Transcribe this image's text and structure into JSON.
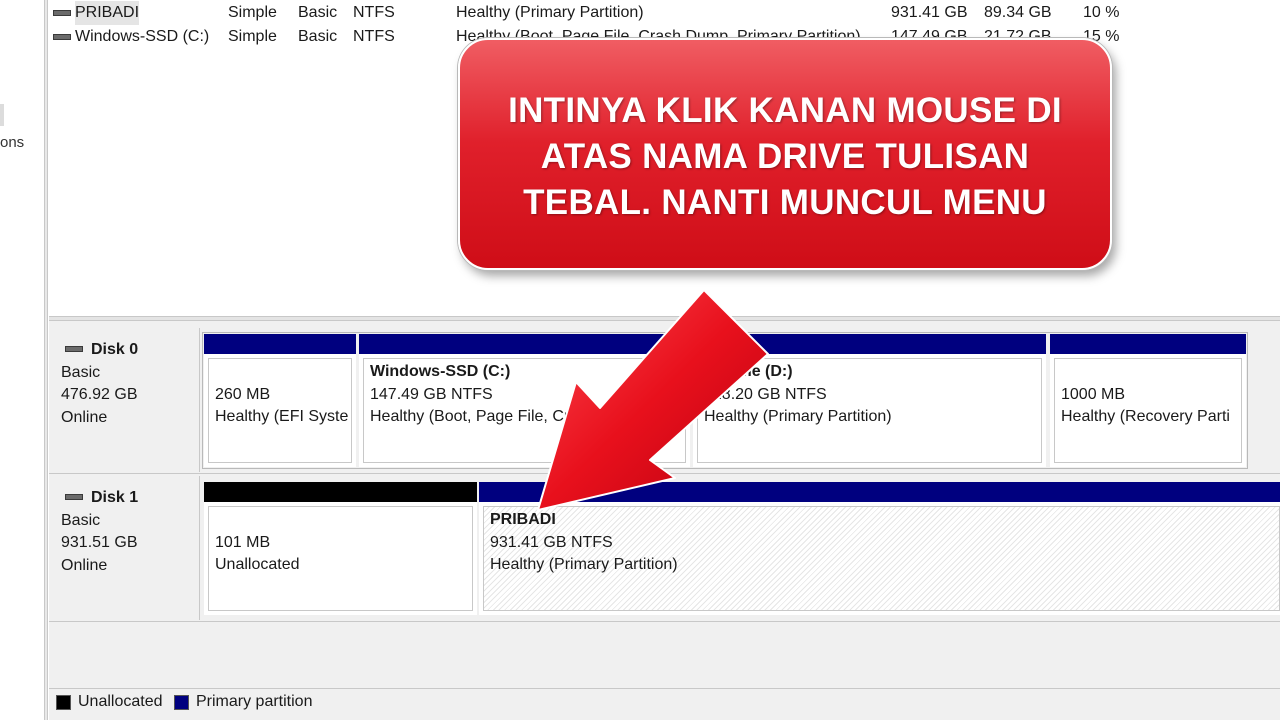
{
  "left_pane": {
    "fragment_text": "ons"
  },
  "volumes": [
    {
      "name": "PRIBADI",
      "layout": "Simple",
      "type": "Basic",
      "fs": "NTFS",
      "status": "Healthy (Primary Partition)",
      "capacity": "931.41 GB",
      "free": "89.34 GB",
      "pct_free": "10 %"
    },
    {
      "name": "Windows-SSD (C:)",
      "layout": "Simple",
      "type": "Basic",
      "fs": "NTFS",
      "status": "Healthy (Boot, Page File, Crash Dump, Primary Partition)",
      "capacity": "147.49 GB",
      "free": "21.72 GB",
      "pct_free": "15 %"
    }
  ],
  "disks": [
    {
      "title": "Disk 0",
      "type": "Basic",
      "size": "476.92 GB",
      "state": "Online",
      "partitions": [
        {
          "name": "",
          "size": "260 MB",
          "status": "Healthy (EFI Syste"
        },
        {
          "name": "Windows-SSD  (C:)",
          "size": "147.49 GB NTFS",
          "status": "Healthy (Boot, Page File, Cr"
        },
        {
          "name": "Volume  (D:)",
          "size": "328.20 GB NTFS",
          "status": "Healthy (Primary Partition)"
        },
        {
          "name": "",
          "size": "1000 MB",
          "status": "Healthy (Recovery Parti"
        }
      ]
    },
    {
      "title": "Disk 1",
      "type": "Basic",
      "size": "931.51 GB",
      "state": "Online",
      "partitions": [
        {
          "name": "",
          "size": "101 MB",
          "status": "Unallocated"
        },
        {
          "name": "PRIBADI",
          "size": "931.41 GB NTFS",
          "status": "Healthy (Primary Partition)"
        }
      ]
    }
  ],
  "legend": [
    {
      "label": "Unallocated",
      "color": "#000000"
    },
    {
      "label": "Primary partition",
      "color": "#00007f"
    }
  ],
  "callout": {
    "text": "INTINYA KLIK KANAN MOUSE DI ATAS NAMA DRIVE TULISAN TEBAL. NANTI MUNCUL MENU"
  },
  "colors": {
    "primary_bar": "#00007f",
    "unallocated_bar": "#000000",
    "callout_red": "#e0202b",
    "arrow_red": "#e8101c"
  },
  "icons": {
    "drive": "drive-icon",
    "arrow": "red-pointer-arrow"
  }
}
